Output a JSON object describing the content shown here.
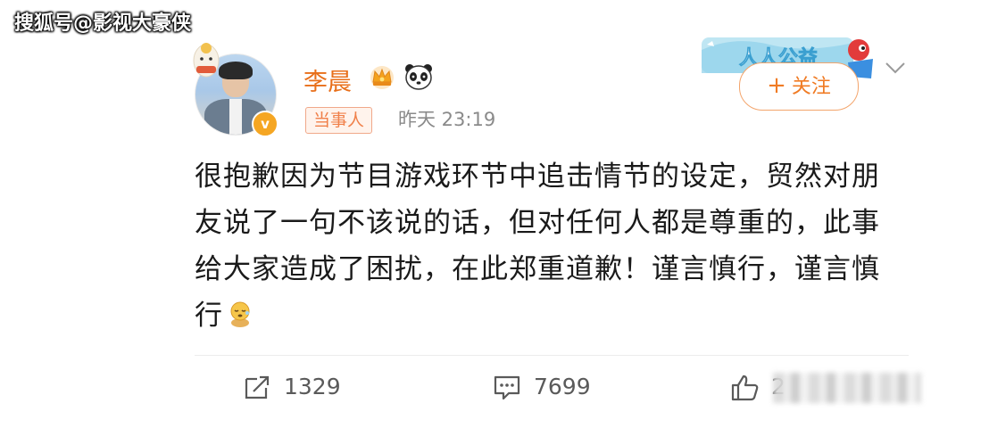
{
  "watermark": "搜狐号@影视大豪侠",
  "post": {
    "username": "李晨",
    "tag": "当事人",
    "time": "昨天 23:19",
    "follow_label": "关注",
    "follow_plus": "+",
    "verified_mark": "v",
    "banner_text": "人人公益",
    "text": "很抱歉因为节目游戏环节中追击情节的设定，贸然对朋友说了一句不该说的话，但对任何人都是尊重的，此事给大家造成了困扰，在此郑重道歉！谨言慎行，谨言慎行"
  },
  "actions": {
    "share_count": "1329",
    "comment_count": "7699",
    "like_count_visible": "2"
  },
  "colors": {
    "username": "#e86f1a",
    "follow_border": "#f3a46b",
    "tag_text": "#f0804a",
    "verified": "#f5a623"
  },
  "icons": [
    "crown-icon",
    "panda-icon",
    "verified-icon",
    "chevron-down-icon",
    "share-icon",
    "comment-icon",
    "like-icon",
    "sleepy-emoji-icon"
  ]
}
